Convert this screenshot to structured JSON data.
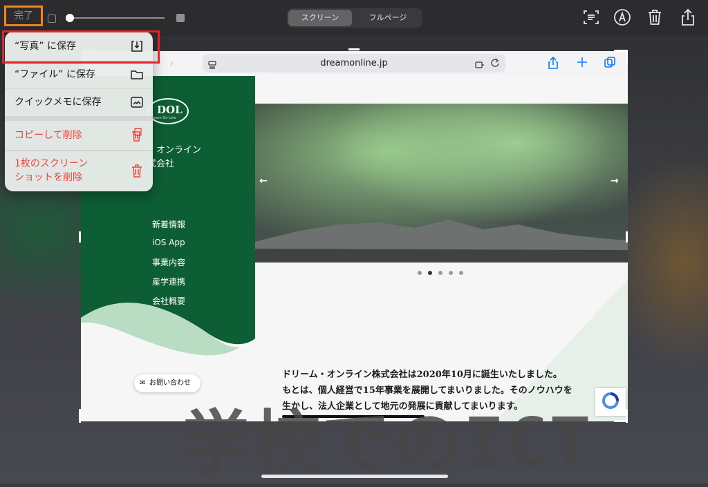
{
  "toolbar": {
    "done_label": "完了",
    "segments": [
      "スクリーン",
      "フルページ"
    ],
    "selected_segment": "スクリーン",
    "icons": [
      "text-scan-icon",
      "markup-pen-icon",
      "trash-icon",
      "share-icon"
    ]
  },
  "menu": {
    "items": [
      {
        "label": "“写真” に保存",
        "icon": "save-download-icon"
      },
      {
        "label": "“ファイル” に保存",
        "icon": "folder-icon"
      },
      {
        "label": "クイックメモに保存",
        "icon": "quick-note-icon"
      },
      {
        "label": "コピーして削除",
        "icon": "copy-trash-icon",
        "destructive": true
      },
      {
        "label_line1": "1枚のスクリーン",
        "label_line2": "ショットを削除",
        "icon": "trash-icon",
        "destructive": true
      }
    ]
  },
  "browser": {
    "url": "dreamonline.jp"
  },
  "site": {
    "logo_text": "DOL",
    "logo_sub": "Dream On Line",
    "company_line1": "・オンライン",
    "company_line2": "式会社",
    "nav": [
      "新着情報",
      "iOS App",
      "事業内容",
      "産学連携",
      "会社概要"
    ],
    "carousel_dots": 5,
    "carousel_active_dot": 2,
    "intro_lines": [
      "ドリーム・オンライン株式会社は2020年10月に誕生いたしました。",
      "もとは、個人経営で15年事業を展開してまいりました。そのノウハウを",
      "生かし、法人企業として地元の発展に貢献してまいります。"
    ],
    "contact_label": "お問い合わせ"
  },
  "watermark": "学校でのICT",
  "colors": {
    "highlight_orange": "#f0861f",
    "highlight_red": "#e0242a",
    "destructive_red": "#e5473b",
    "site_green": "#0d5e35",
    "link_blue": "#0a7aff"
  }
}
